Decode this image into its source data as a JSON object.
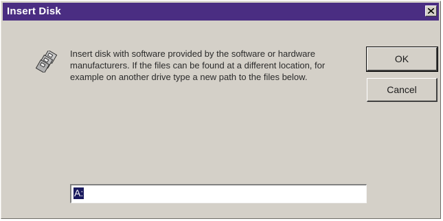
{
  "window": {
    "title": "Insert Disk",
    "close_icon": "close-x-icon"
  },
  "dialog": {
    "icon": "disks-icon",
    "message": "Insert disk with software provided by the software or hardware manufacturers.  If the files can be found at a different location, for example on another drive type a new path to the files below."
  },
  "buttons": {
    "ok_label": "OK",
    "cancel_label": "Cancel"
  },
  "path_field": {
    "value": "A:"
  },
  "colors": {
    "titlebar": "#4a2d82",
    "dialog_bg": "#d4d0c8"
  }
}
